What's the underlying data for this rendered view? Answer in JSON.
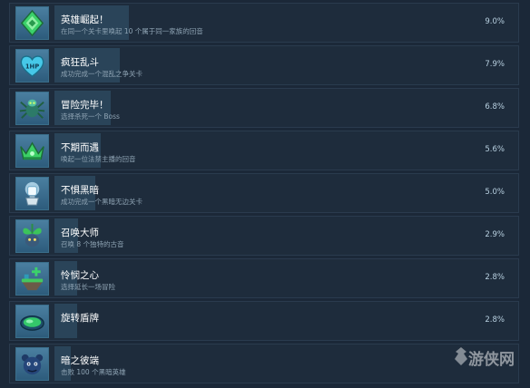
{
  "achievements": [
    {
      "title": "英雄崛起！",
      "desc": "在同一个关卡里唤起 10 个属于同一家族的回音",
      "pct": "9.0%",
      "progress": 0.09,
      "icon": "green-diamond-crest-icon"
    },
    {
      "title": "疯狂乱斗",
      "desc": "成功完成一个混乱之争关卡",
      "pct": "7.9%",
      "progress": 0.079,
      "icon": "heart-1hp-icon"
    },
    {
      "title": "冒险完毕！",
      "desc": "选择杀死一个 Boss",
      "pct": "6.8%",
      "progress": 0.068,
      "icon": "spider-boss-icon"
    },
    {
      "title": "不期而遇",
      "desc": "唤起一位法禁主播的回音",
      "pct": "5.6%",
      "progress": 0.056,
      "icon": "green-crown-icon"
    },
    {
      "title": "不惧黑暗",
      "desc": "成功完成一个黑暗无边关卡",
      "pct": "5.0%",
      "progress": 0.05,
      "icon": "glowing-lantern-icon"
    },
    {
      "title": "召唤大师",
      "desc": "召唤 8 个独特的古音",
      "pct": "2.9%",
      "progress": 0.029,
      "icon": "leaf-creature-icon"
    },
    {
      "title": "怜悯之心",
      "desc": "选择延长一场冒险",
      "pct": "2.8%",
      "progress": 0.028,
      "icon": "floating-island-plus-icon"
    },
    {
      "title": "旋转盾牌",
      "desc": "",
      "pct": "2.8%",
      "progress": 0.028,
      "icon": "green-pool-shield-icon"
    },
    {
      "title": "暗之彼端",
      "desc": "击败 100 个黑暗英雄",
      "pct": "",
      "progress": 0.02,
      "icon": "dark-bear-creature-icon"
    }
  ],
  "watermark": "游侠网"
}
